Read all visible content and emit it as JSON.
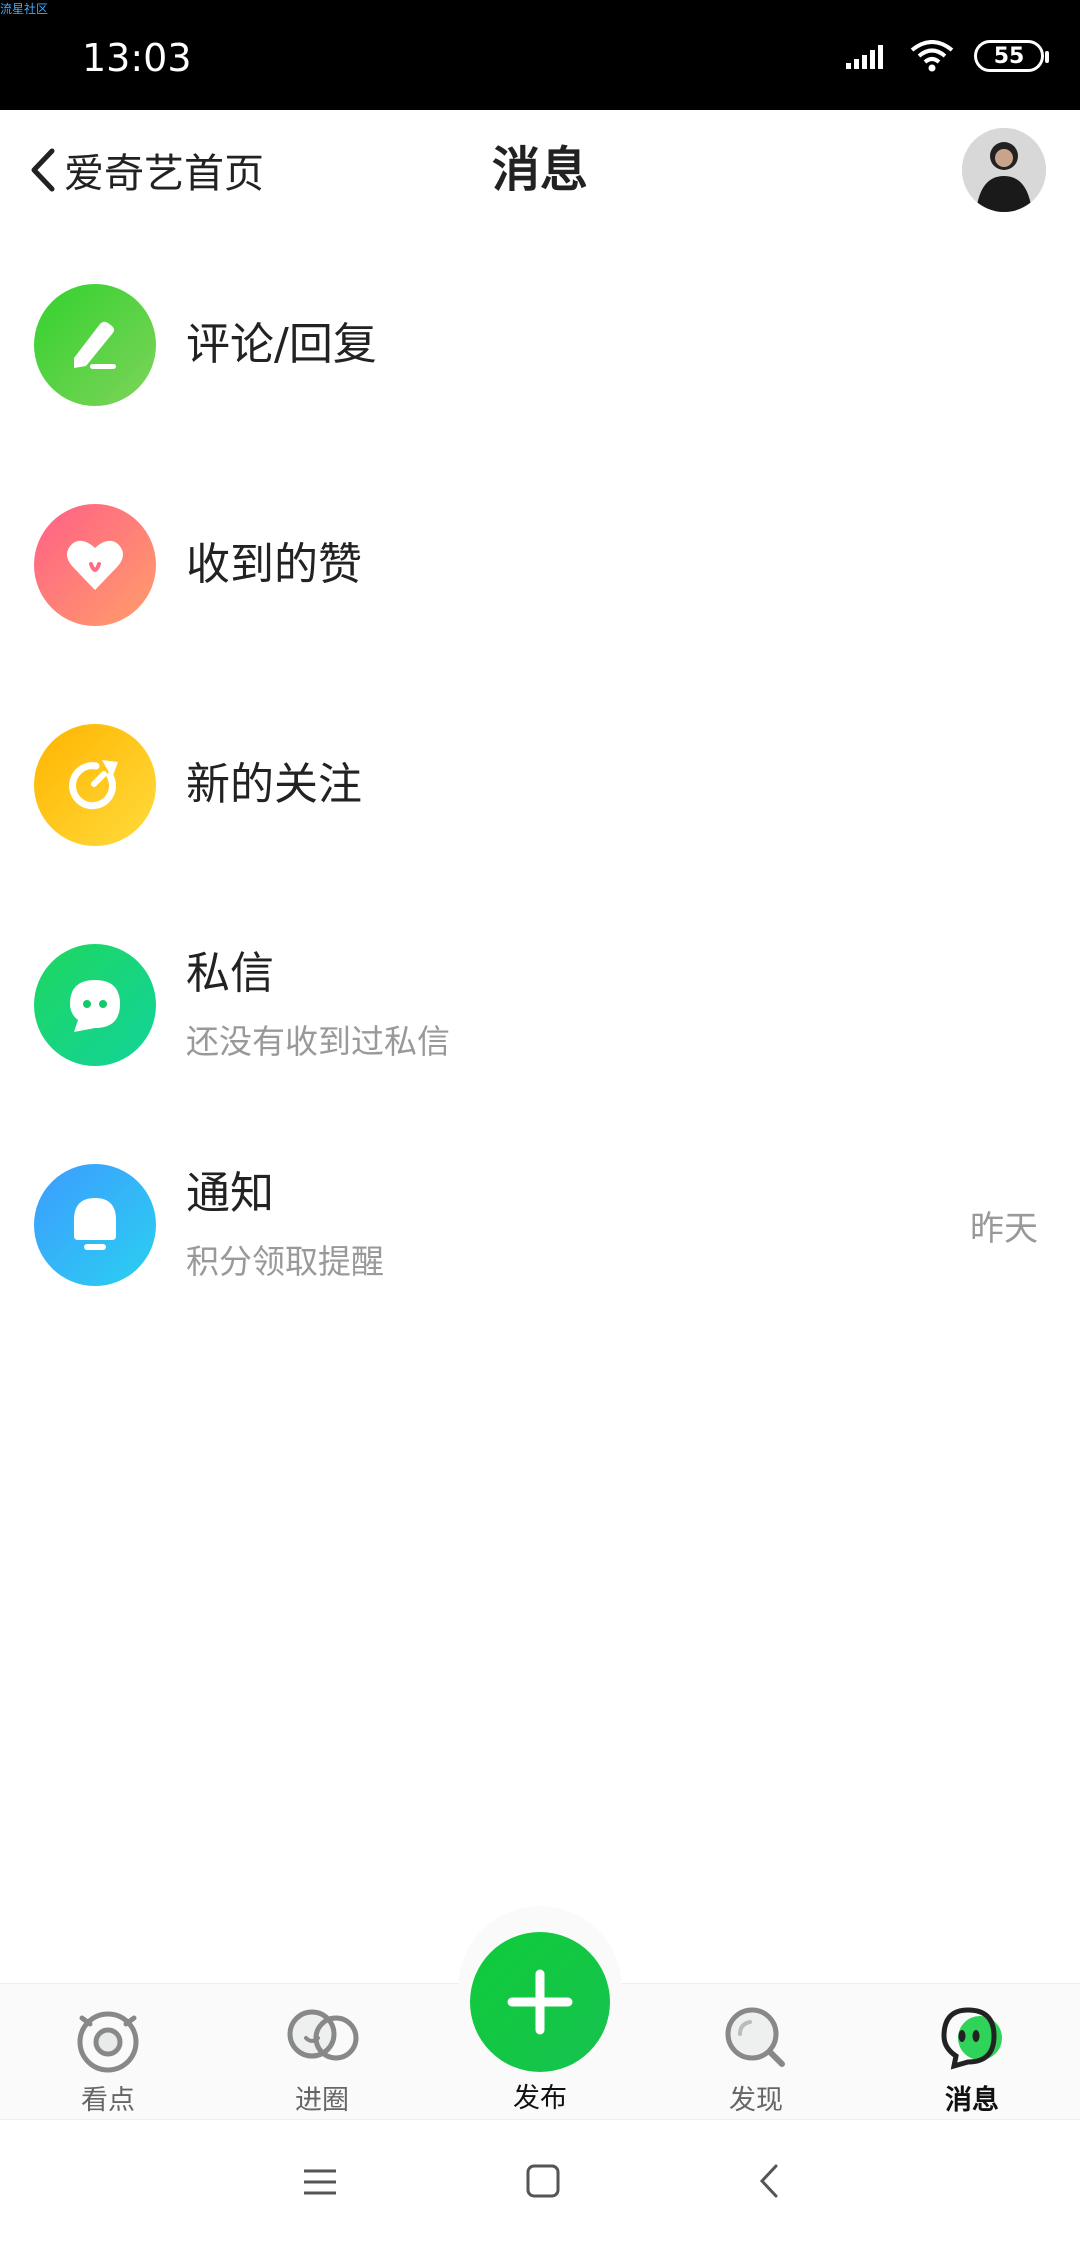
{
  "status_bar": {
    "corner_text": "流星社区",
    "time": "13:03",
    "battery": "55"
  },
  "header": {
    "back_label": "爱奇艺首页",
    "title": "消息"
  },
  "messages": [
    {
      "title": "评论/回复",
      "subtitle": "",
      "time": "",
      "icon": "pencil-icon",
      "colors": [
        "#33d12e",
        "#7ed45a"
      ]
    },
    {
      "title": "收到的赞",
      "subtitle": "",
      "time": "",
      "icon": "heart-icon",
      "colors": [
        "#ff5f86",
        "#ff9f6a"
      ]
    },
    {
      "title": "新的关注",
      "subtitle": "",
      "time": "",
      "icon": "follow-icon",
      "colors": [
        "#ffb400",
        "#ffdb3c"
      ]
    },
    {
      "title": "私信",
      "subtitle": "还没有收到过私信",
      "time": "",
      "icon": "chat-bubble-icon",
      "colors": [
        "#1ed760",
        "#12d39a"
      ]
    },
    {
      "title": "通知",
      "subtitle": "积分领取提醒",
      "time": "昨天",
      "icon": "bell-icon",
      "colors": [
        "#3d9cff",
        "#2ad0f0"
      ]
    }
  ],
  "bottom_nav": {
    "items": [
      {
        "label": "看点",
        "icon": "eye-watch-icon"
      },
      {
        "label": "进圈",
        "icon": "circles-icon"
      },
      {
        "label": "发布",
        "icon": "plus-icon"
      },
      {
        "label": "发现",
        "icon": "discover-search-icon"
      },
      {
        "label": "消息",
        "icon": "message-face-icon"
      }
    ],
    "active": "消息"
  },
  "colors": {
    "accent_green": "#17c24f"
  }
}
